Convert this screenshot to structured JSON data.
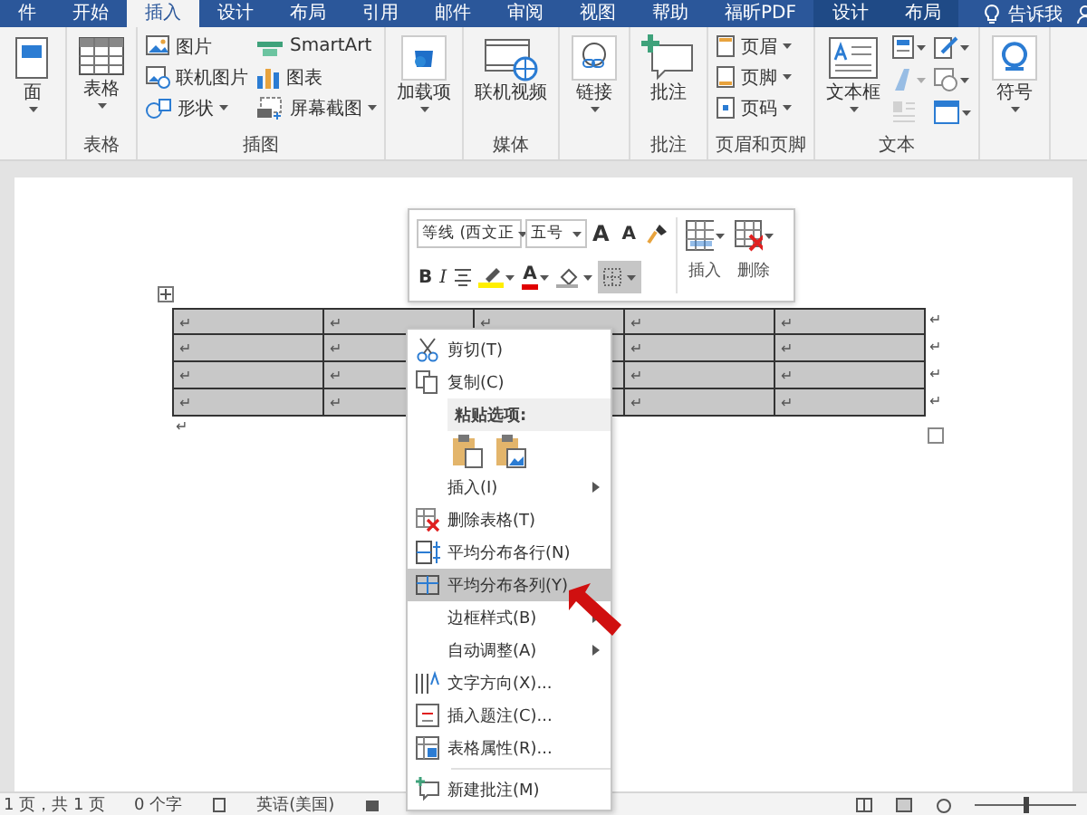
{
  "tabs": [
    {
      "label": "件",
      "kind": "normal",
      "selected": false
    },
    {
      "label": "开始",
      "kind": "normal",
      "selected": false
    },
    {
      "label": "插入",
      "kind": "normal",
      "selected": true
    },
    {
      "label": "设计",
      "kind": "normal",
      "selected": false
    },
    {
      "label": "布局",
      "kind": "normal",
      "selected": false
    },
    {
      "label": "引用",
      "kind": "normal",
      "selected": false
    },
    {
      "label": "邮件",
      "kind": "normal",
      "selected": false
    },
    {
      "label": "审阅",
      "kind": "normal",
      "selected": false
    },
    {
      "label": "视图",
      "kind": "normal",
      "selected": false
    },
    {
      "label": "帮助",
      "kind": "normal",
      "selected": false
    },
    {
      "label": "福昕PDF",
      "kind": "normal",
      "selected": false
    },
    {
      "label": "设计",
      "kind": "contextual",
      "selected": false
    },
    {
      "label": "布局",
      "kind": "contextual",
      "selected": false
    }
  ],
  "tell_me": "告诉我",
  "ribbon": [
    {
      "items": [
        {
          "kind": "large",
          "label": "面",
          "dropdown": true
        }
      ]
    },
    {
      "label": "表格",
      "items": [
        {
          "kind": "large",
          "label": "表格",
          "dropdown": true
        }
      ]
    },
    {
      "label": "插图",
      "items": [
        {
          "kind": "small",
          "label": "图片",
          "dropdown": false
        },
        {
          "kind": "small",
          "label": "联机图片",
          "dropdown": false
        },
        {
          "kind": "small",
          "label": "形状",
          "dropdown": true
        },
        {
          "kind": "small",
          "label": "SmartArt",
          "dropdown": false
        },
        {
          "kind": "small",
          "label": "图表",
          "dropdown": false
        },
        {
          "kind": "small",
          "label": "屏幕截图",
          "dropdown": true
        }
      ]
    },
    {
      "items": [
        {
          "kind": "large",
          "label": "加载项",
          "dropdown": true
        }
      ]
    },
    {
      "label": "媒体",
      "items": [
        {
          "kind": "large",
          "label": "联机视频",
          "dropdown": false
        }
      ]
    },
    {
      "items": [
        {
          "kind": "large",
          "label": "链接",
          "dropdown": true
        }
      ]
    },
    {
      "label": "批注",
      "items": [
        {
          "kind": "large",
          "label": "批注",
          "dropdown": false
        }
      ]
    },
    {
      "label": "页眉和页脚",
      "items": [
        {
          "kind": "small",
          "label": "页眉",
          "dropdown": true
        },
        {
          "kind": "small",
          "label": "页脚",
          "dropdown": true
        },
        {
          "kind": "small",
          "label": "页码",
          "dropdown": true
        }
      ]
    },
    {
      "label": "文本",
      "items": [
        {
          "kind": "large",
          "label": "文本框",
          "dropdown": true
        },
        {
          "kind": "icon",
          "dropdown": true,
          "disabled": false
        },
        {
          "kind": "icon",
          "dropdown": true,
          "disabled": false
        },
        {
          "kind": "icon",
          "dropdown": true,
          "disabled": true
        },
        {
          "kind": "icon",
          "dropdown": true,
          "disabled": false
        },
        {
          "kind": "icon",
          "dropdown": false,
          "disabled": true
        },
        {
          "kind": "icon",
          "dropdown": true,
          "disabled": false
        }
      ]
    },
    {
      "items": [
        {
          "kind": "large",
          "label": "符号",
          "dropdown": true
        }
      ]
    }
  ],
  "mini_toolbar": {
    "font": "等线 (西文正",
    "size": "五号",
    "grow_font": "A",
    "shrink_font": "A",
    "bold": "B",
    "italic": "I",
    "font_color": "A",
    "borders_active": true,
    "insert": "插入",
    "delete": "删除"
  },
  "table": {
    "selected": true,
    "rows": [
      {
        "cells": [
          "↵",
          "↵",
          "↵",
          "↵",
          "↵"
        ],
        "end_mark": "↵"
      },
      {
        "cells": [
          "↵",
          "↵",
          null,
          "↵",
          "↵"
        ],
        "end_mark": "↵"
      },
      {
        "cells": [
          "↵",
          "↵",
          null,
          "↵",
          "↵"
        ],
        "end_mark": "↵"
      },
      {
        "cells": [
          "↵",
          "↵",
          null,
          "↵",
          "↵"
        ],
        "end_mark": "↵"
      }
    ],
    "after_mark": "↵"
  },
  "context_menu": [
    {
      "kind": "command",
      "label": "剪切(T)",
      "submenu": false,
      "selected": false
    },
    {
      "kind": "command",
      "label": "复制(C)",
      "submenu": false,
      "selected": false
    },
    {
      "kind": "header",
      "label": "粘贴选项:"
    },
    {
      "kind": "paste"
    },
    {
      "kind": "command",
      "label": "插入(I)",
      "submenu": true,
      "selected": false
    },
    {
      "kind": "command",
      "label": "删除表格(T)",
      "submenu": false,
      "selected": false
    },
    {
      "kind": "command",
      "label": "平均分布各行(N)",
      "submenu": false,
      "selected": false
    },
    {
      "kind": "command",
      "label": "平均分布各列(Y)",
      "submenu": false,
      "selected": true
    },
    {
      "kind": "command",
      "label": "边框样式(B)",
      "submenu": true,
      "selected": false
    },
    {
      "kind": "command",
      "label": "自动调整(A)",
      "submenu": true,
      "selected": false
    },
    {
      "kind": "command",
      "label": "文字方向(X)...",
      "submenu": false,
      "selected": false
    },
    {
      "kind": "command",
      "label": "插入题注(C)...",
      "submenu": false,
      "selected": false
    },
    {
      "kind": "command",
      "label": "表格属性(R)...",
      "submenu": false,
      "selected": false
    },
    {
      "kind": "separator"
    },
    {
      "kind": "command",
      "label": "新建批注(M)",
      "submenu": false,
      "selected": false
    }
  ],
  "status_bar": {
    "page": "1 页，共 1 页",
    "words": "0 个字",
    "language": "英语(美国)",
    "zoom": {
      "level": 0.5
    }
  }
}
